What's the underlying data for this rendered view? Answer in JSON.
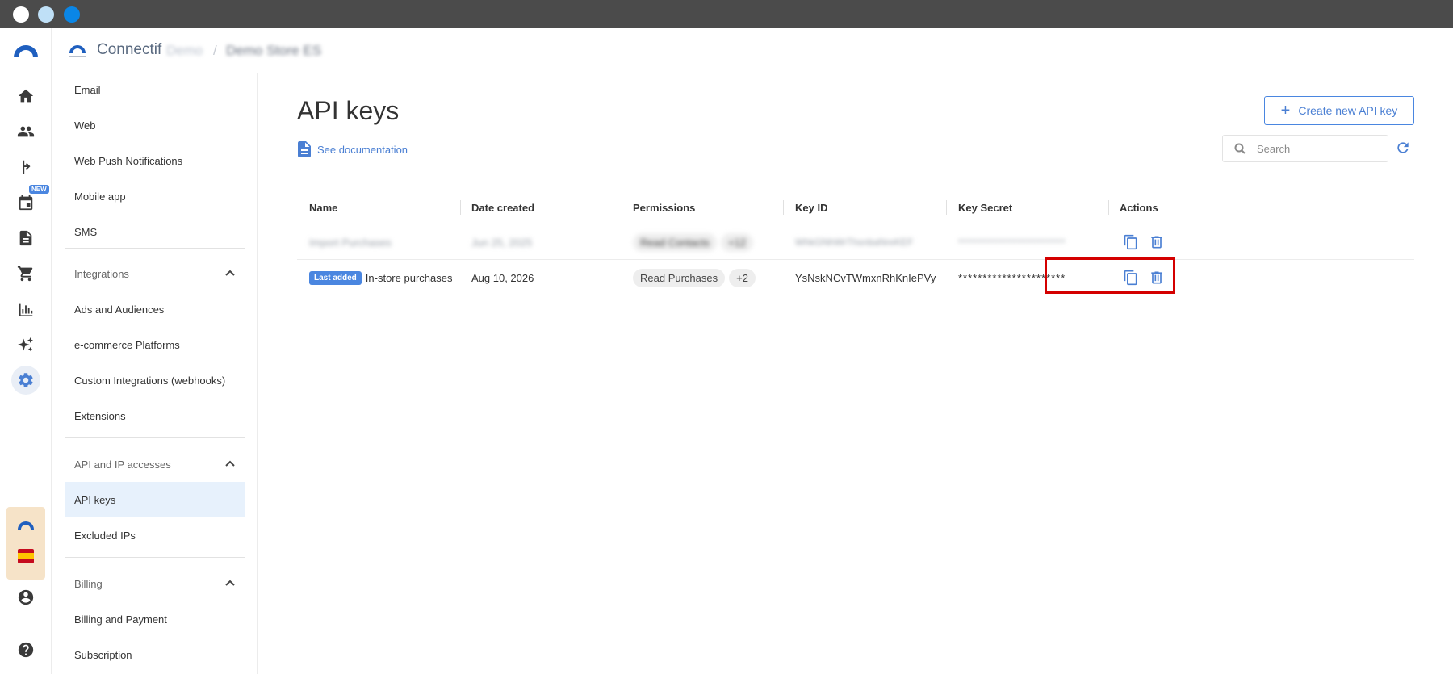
{
  "header": {
    "brand": "Connectif",
    "account_blurred": "Demo",
    "separator": "/",
    "store_blurred": "Demo Store ES"
  },
  "rail": {
    "new_badge": "NEW"
  },
  "nav": {
    "top_items": [
      "Email",
      "Web",
      "Web Push Notifications",
      "Mobile app",
      "SMS"
    ],
    "sections": [
      {
        "label": "Integrations",
        "items": [
          "Ads and Audiences",
          "e-commerce Platforms",
          "Custom Integrations (webhooks)",
          "Extensions"
        ]
      },
      {
        "label": "API and IP accesses",
        "items": [
          "API keys",
          "Excluded IPs"
        ]
      },
      {
        "label": "Billing",
        "items": [
          "Billing and Payment",
          "Subscription"
        ]
      }
    ],
    "active_item": "API keys"
  },
  "page": {
    "title": "API keys",
    "doc_link": "See documentation",
    "create_button": "Create new API key",
    "search_placeholder": "Search"
  },
  "table": {
    "columns": [
      "Name",
      "Date created",
      "Permissions",
      "Key ID",
      "Key Secret",
      "Actions"
    ],
    "rows": [
      {
        "badge": "",
        "name": "Import Purchases",
        "date": "Jun 25, 2025",
        "permission": "Read Contacts",
        "extra": "+12",
        "key_id": "WhkGNhWrThsnbaNreKEF",
        "secret": "**********************",
        "blurred": true
      },
      {
        "badge": "Last added",
        "name": "In-store purchases",
        "date": "Aug 10, 2026",
        "permission": "Read Purchases",
        "extra": "+2",
        "key_id": "YsNskNCvTWmxnRhKnIePVy",
        "secret": "**********************",
        "blurred": false
      }
    ]
  },
  "colors": {
    "accent": "#4a7fd3",
    "highlight": "#d40000",
    "active_nav_bg": "#e7f1fc"
  }
}
